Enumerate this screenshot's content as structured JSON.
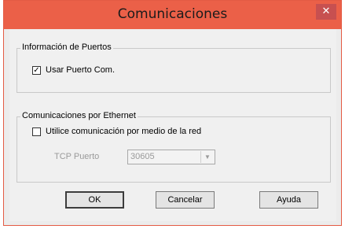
{
  "window": {
    "title": "Comunicaciones",
    "close_glyph": "✕"
  },
  "group_ports": {
    "title": "Información de Puertos",
    "use_com_label": "Usar Puerto Com.",
    "use_com_checked": true
  },
  "group_ethernet": {
    "title": "Comunicaciones por Ethernet",
    "use_network_label": "Utilice comunicación por medio de la red",
    "use_network_checked": false,
    "tcp_port_label": "TCP Puerto",
    "tcp_port_value": "30605"
  },
  "buttons": {
    "ok": "OK",
    "cancel": "Cancelar",
    "help": "Ayuda"
  },
  "colors": {
    "titlebar": "#eb6048",
    "close": "#c75050",
    "face": "#f0f0f0"
  }
}
